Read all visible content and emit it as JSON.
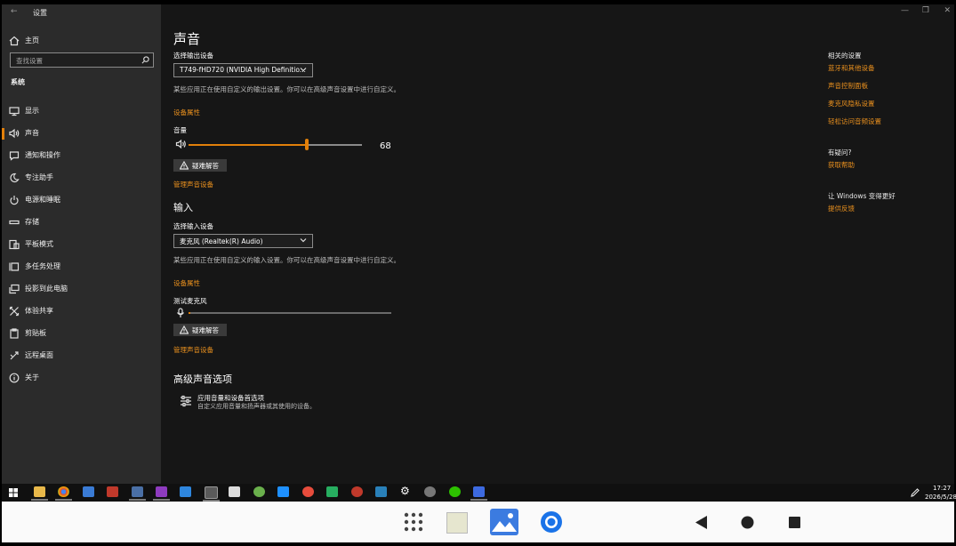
{
  "window": {
    "title": "设置"
  },
  "sidebar": {
    "home": "主页",
    "search_placeholder": "查找设置",
    "section": "系统",
    "items": [
      {
        "label": "显示",
        "icon": "monitor-icon"
      },
      {
        "label": "声音",
        "icon": "speaker-icon"
      },
      {
        "label": "通知和操作",
        "icon": "notification-icon"
      },
      {
        "label": "专注助手",
        "icon": "moon-icon"
      },
      {
        "label": "电源和睡眠",
        "icon": "power-icon"
      },
      {
        "label": "存储",
        "icon": "storage-icon"
      },
      {
        "label": "平板模式",
        "icon": "tablet-icon"
      },
      {
        "label": "多任务处理",
        "icon": "multitask-icon"
      },
      {
        "label": "投影到此电脑",
        "icon": "project-icon"
      },
      {
        "label": "体验共享",
        "icon": "share-icon"
      },
      {
        "label": "剪贴板",
        "icon": "clipboard-icon"
      },
      {
        "label": "远程桌面",
        "icon": "remote-icon"
      },
      {
        "label": "关于",
        "icon": "info-icon"
      }
    ]
  },
  "main": {
    "title": "声音",
    "output": {
      "select_label": "选择输出设备",
      "device": "T749-fHD720 (NVIDIA High Definitio...",
      "desc": "某些应用正在使用自定义的输出设置。你可以在高级声音设置中进行自定义。",
      "props_link": "设备属性",
      "volume_label": "音量",
      "volume": 68,
      "troubleshoot": "疑难解答",
      "manage_link": "管理声音设备"
    },
    "input": {
      "heading": "输入",
      "select_label": "选择输入设备",
      "device": "麦克风 (Realtek(R) Audio)",
      "desc": "某些应用正在使用自定义的输入设置。你可以在高级声音设置中进行自定义。",
      "props_link": "设备属性",
      "test_label": "测试麦克风",
      "mic_level": 0.01,
      "troubleshoot": "疑难解答",
      "manage_link": "管理声音设备"
    },
    "advanced": {
      "heading": "高级声音选项",
      "item_title": "应用音量和设备首选项",
      "item_desc": "自定义应用音量和扬声器或其使用的设备。"
    }
  },
  "related": {
    "title": "相关的设置",
    "links": [
      "蓝牙和其他设备",
      "声音控制面板",
      "麦克风隐私设置",
      "轻松访问音频设置"
    ],
    "question_title": "有疑问?",
    "question_link": "获取帮助",
    "improve_title": "让 Windows 变得更好",
    "improve_link": "提供反馈"
  },
  "taskbar": {
    "time": "17:27",
    "date": "2026/5/28"
  },
  "accent_color": "#e2800a"
}
